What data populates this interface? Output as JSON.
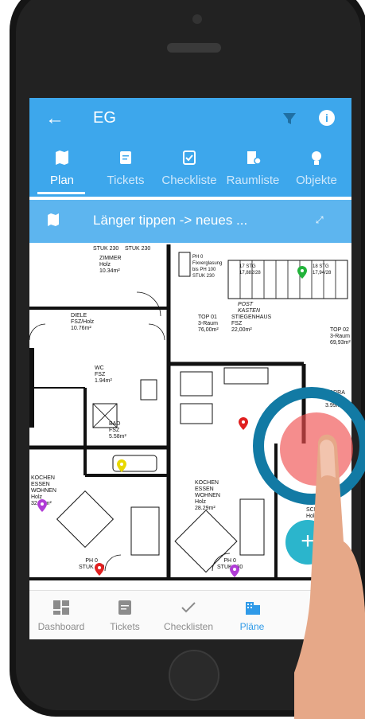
{
  "appbar": {
    "title": "EG"
  },
  "tabs": [
    {
      "label": "Plan",
      "icon": "map-icon"
    },
    {
      "label": "Tickets",
      "icon": "ticket-icon"
    },
    {
      "label": "Checkliste",
      "icon": "checklist-icon"
    },
    {
      "label": "Raumliste",
      "icon": "roomlist-icon"
    },
    {
      "label": "Objekte",
      "icon": "lightbulb-icon"
    }
  ],
  "hint": {
    "text": "Länger tippen -> neues ..."
  },
  "floorplan": {
    "rooms": [
      {
        "text": "STUK 230"
      },
      {
        "text": "STUK 230"
      },
      {
        "text": "ZIMMER\nHolz\n10.34m²"
      },
      {
        "text": "PH 0\nFixverglasung\nbis PH 100\nSTUK 230"
      },
      {
        "text": "17 STG\n17,882/28"
      },
      {
        "text": "18 STG\n17,94/28"
      },
      {
        "text": "POST\nKASTEN"
      },
      {
        "text": "DIELE\nFSZ/Holz\n10.76m²"
      },
      {
        "text": "TOP 01\n3-Raum\n76,00m²"
      },
      {
        "text": "STIEGENHAUS\nFSZ\n22,00m²"
      },
      {
        "text": "TOP 02\n3-Raum\n69,93m²"
      },
      {
        "text": "WC\nFSZ\n1.94m²"
      },
      {
        "text": "BAD\nFSZ\n5.58m²"
      },
      {
        "text": "VORRA\nFSZ\n3.99m²"
      },
      {
        "text": "KOCHEN\nESSEN\nWOHNEN\nHolz\n32.36m²"
      },
      {
        "text": "KOCHEN\nESSEN\nWOHNEN\nHolz\n28.29m²"
      },
      {
        "text": "SCH\nHolz"
      },
      {
        "text": "PH 0\nSTUK 230"
      },
      {
        "text": "PH 0\nSTUK 230"
      }
    ]
  },
  "bottomnav": [
    {
      "label": "Dashboard",
      "icon": "dashboard-icon"
    },
    {
      "label": "Tickets",
      "icon": "ticket-icon"
    },
    {
      "label": "Checklisten",
      "icon": "check-icon"
    },
    {
      "label": "Pläne",
      "icon": "building-icon"
    }
  ],
  "colors": {
    "accent": "#3da7ec",
    "accent_light": "#5db5ef",
    "fab": "#2bb5cc",
    "nav_active": "#2f9ae8"
  }
}
